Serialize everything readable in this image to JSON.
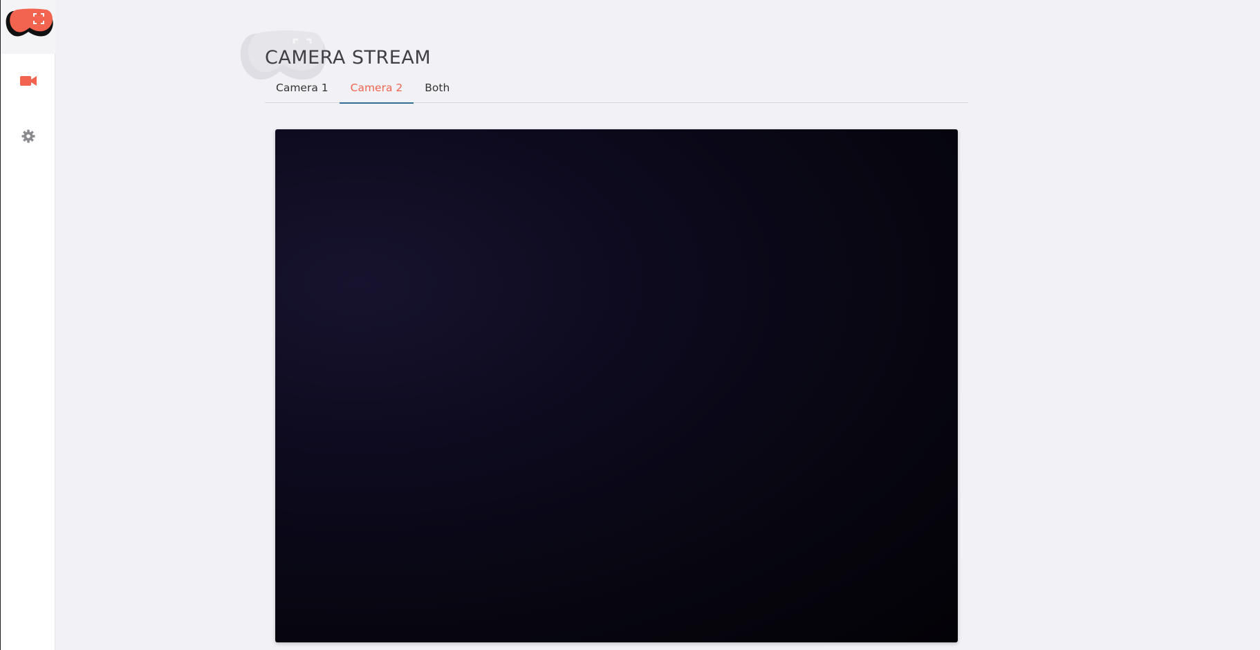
{
  "app": {
    "accent_color": "#f2644f",
    "logo_icon": "goggles-logo-icon"
  },
  "sidebar": {
    "items": [
      {
        "icon": "video-camera-icon",
        "active": true
      },
      {
        "icon": "gear-icon",
        "active": false
      }
    ]
  },
  "page": {
    "title": "CAMERA STREAM"
  },
  "tabs": [
    {
      "label": "Camera 1",
      "active": false
    },
    {
      "label": "Camera 2",
      "active": true
    },
    {
      "label": "Both",
      "active": false
    }
  ],
  "stream": {
    "background_color": "#07060f"
  }
}
